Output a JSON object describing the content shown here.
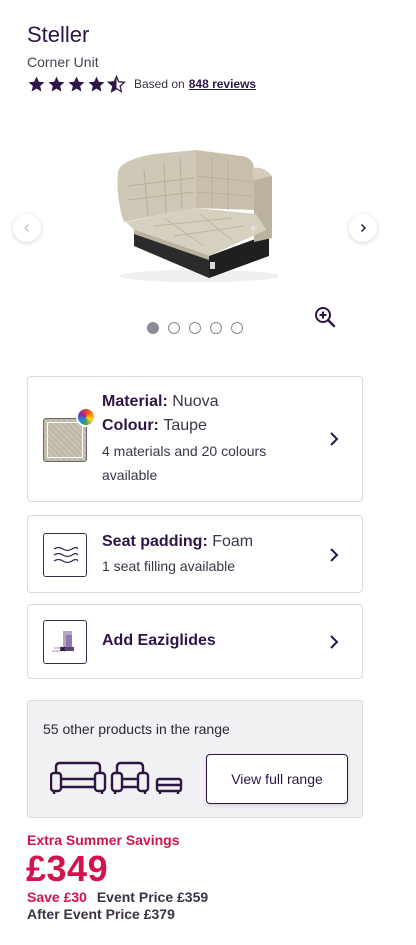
{
  "product": {
    "title": "Steller",
    "subtitle": "Corner Unit",
    "rating_value": 4.5,
    "rating_prefix": "Based on",
    "reviews_link": "848 reviews"
  },
  "carousel": {
    "image_count": 5,
    "active_index": 0
  },
  "options": {
    "material_label": "Material:",
    "material_value": "Nuova",
    "colour_label": "Colour:",
    "colour_value": "Taupe",
    "material_note_line1": "4 materials and 20 colours",
    "material_note_line2": "available",
    "padding_label": "Seat padding:",
    "padding_value": "Foam",
    "padding_note": "1 seat filling available",
    "glides_label": "Add Eaziglides"
  },
  "range": {
    "text": "55 other products in the range",
    "button_label": "View full range"
  },
  "pricing": {
    "promo": "Extra Summer Savings",
    "price": "£349",
    "save": "Save £30",
    "event_price": "Event Price £359",
    "after_event": "After Event Price £379"
  },
  "colors": {
    "accent": "#d3134c",
    "brand": "#2d1645"
  },
  "icons": {
    "rating": "star-icon",
    "prev": "chevron-left-icon",
    "next": "chevron-right-icon",
    "zoom": "zoom-in-icon",
    "padding": "wave-layers-icon",
    "glides": "eaziglides-icon",
    "range": "sofa-set-icon"
  }
}
